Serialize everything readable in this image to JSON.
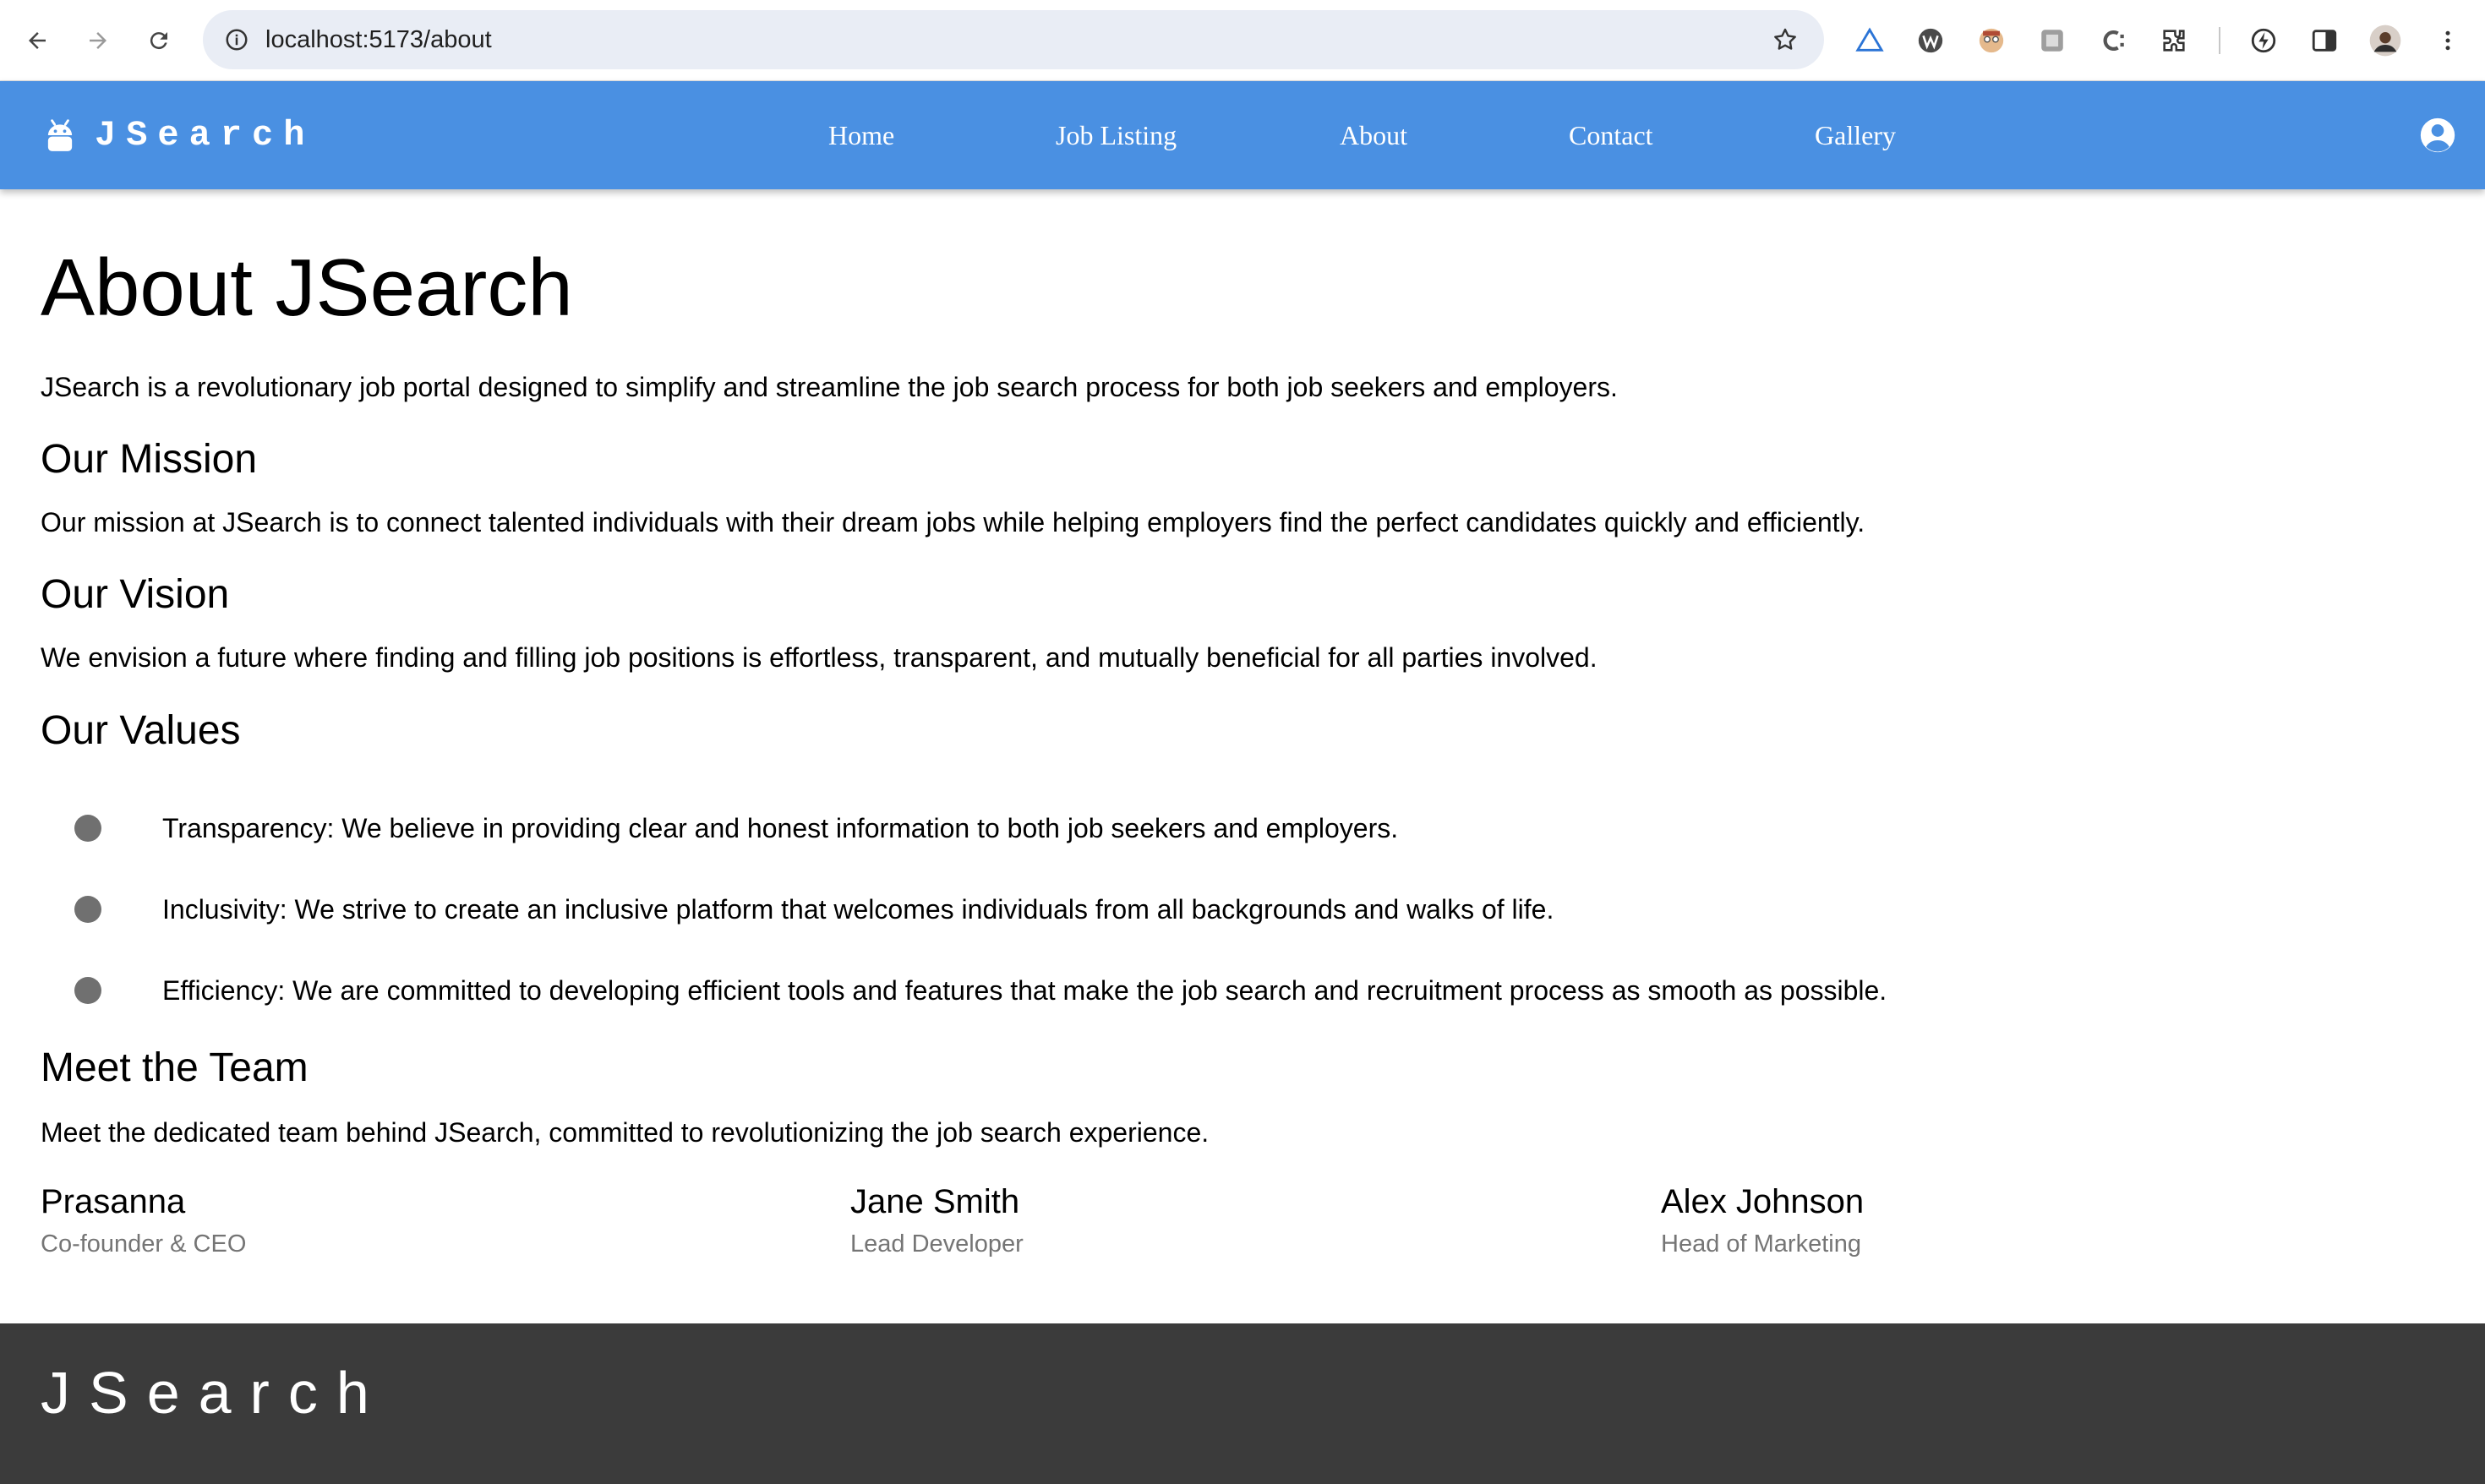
{
  "browser": {
    "url": "localhost:5173/about",
    "accent": "#4a90e2"
  },
  "navbar": {
    "brand": "JSearch",
    "links": [
      "Home",
      "Job Listing",
      "About",
      "Contact",
      "Gallery"
    ]
  },
  "about": {
    "title": "About JSearch",
    "intro": "JSearch is a revolutionary job portal designed to simplify and streamline the job search process for both job seekers and employers.",
    "mission_heading": "Our Mission",
    "mission_text": "Our mission at JSearch is to connect talented individuals with their dream jobs while helping employers find the perfect candidates quickly and efficiently.",
    "vision_heading": "Our Vision",
    "vision_text": "We envision a future where finding and filling job positions is effortless, transparent, and mutually beneficial for all parties involved.",
    "values_heading": "Our Values",
    "values": [
      "Transparency: We believe in providing clear and honest information to both job seekers and employers.",
      "Inclusivity: We strive to create an inclusive platform that welcomes individuals from all backgrounds and walks of life.",
      "Efficiency: We are committed to developing efficient tools and features that make the job search and recruitment process as smooth as possible."
    ],
    "team_heading": "Meet the Team",
    "team_text": "Meet the dedicated team behind JSearch, committed to revolutionizing the job search experience.",
    "team": [
      {
        "name": "Prasanna",
        "role": "Co-founder & CEO"
      },
      {
        "name": "Jane Smith",
        "role": "Lead Developer"
      },
      {
        "name": "Alex Johnson",
        "role": "Head of Marketing"
      }
    ]
  },
  "footer": {
    "brand": "JSearch",
    "background": "#3b3b3b"
  }
}
